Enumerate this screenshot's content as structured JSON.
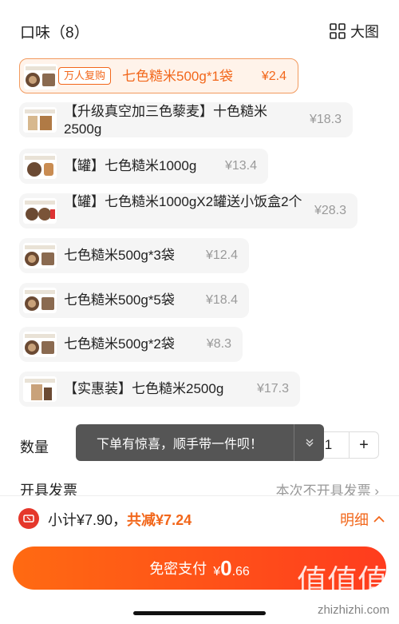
{
  "header": {
    "title": "口味（8）",
    "bigview_label": "大图",
    "bigview_icon": "grid-icon"
  },
  "options": [
    {
      "badge": "万人复购",
      "name": "七色糙米500g*1袋",
      "price": "¥2.4",
      "selected": true
    },
    {
      "name": "【升级真空加三色藜麦】十色糙米2500g",
      "price": "¥18.3"
    },
    {
      "name": "【罐】七色糙米1000g",
      "price": "¥13.4"
    },
    {
      "name": "【罐】七色糙米1000gX2罐送小饭盒2个",
      "price": "¥28.3"
    },
    {
      "name": "七色糙米500g*3袋",
      "price": "¥12.4"
    },
    {
      "name": "七色糙米500g*5袋",
      "price": "¥18.4"
    },
    {
      "name": "七色糙米500g*2袋",
      "price": "¥8.3"
    },
    {
      "name": "【实惠装】七色糙米2500g",
      "price": "¥17.3"
    }
  ],
  "quantity": {
    "label": "数量",
    "value": "1",
    "plus": "+"
  },
  "toast": {
    "text": "下单有惊喜，顺手带一件呗！",
    "chevron_icon": "chevron-down-icon"
  },
  "invoice": {
    "label": "开具发票",
    "value": "本次不开具发票 ›"
  },
  "summary": {
    "subtotal": "小计¥7.90，",
    "discount": "共减¥7.24",
    "detail": "明细",
    "detail_icon": "chevron-up-icon"
  },
  "pay": {
    "label": "免密支付",
    "currency": "¥",
    "amount": "0",
    "decimals": ".66"
  },
  "watermark": {
    "text": "zhizhizhi.com"
  },
  "colors": {
    "accent": "#f2671b",
    "pay_start": "#ff6a12",
    "pay_end": "#ff3c1e",
    "toast_bg": "#555555"
  }
}
